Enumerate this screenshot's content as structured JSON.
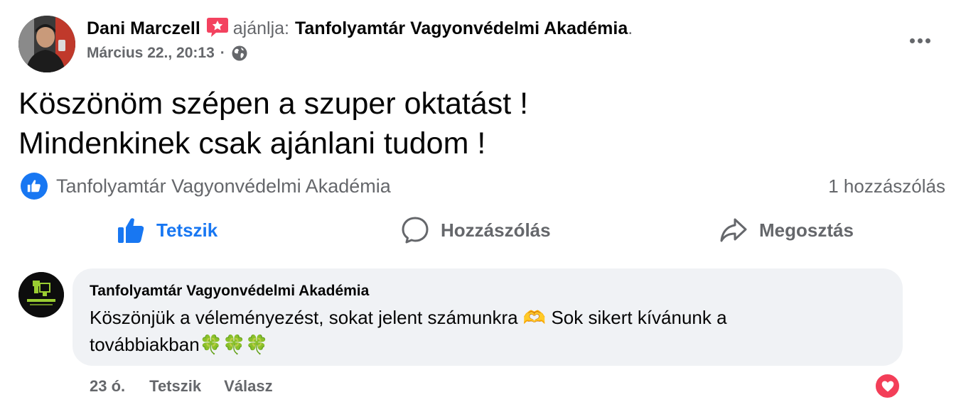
{
  "post": {
    "author": "Dani Marczell",
    "recommend_verb": "ajánlja:",
    "page_name": "Tanfolyamtár Vagyonvédelmi Akadémia",
    "period": ".",
    "timestamp": "Március 22., 20:13",
    "separator": "·",
    "audience_icon": "globe-icon",
    "recommend_icon": "recommend-star-icon",
    "more_icon": "more-options-icon",
    "text_lines": [
      "Köszönöm szépen a szuper oktatást !",
      "Mindenkinek csak ajánlani tudom !"
    ]
  },
  "reactions": {
    "icon": "like-icon",
    "reactors": "Tanfolyamtár Vagyonvédelmi Akadémia",
    "comment_count": "1 hozzászólás"
  },
  "actions": {
    "like": "Tetszik",
    "comment": "Hozzászólás",
    "share": "Megosztás"
  },
  "comment": {
    "author": "Tanfolyamtár Vagyonvédelmi Akadémia",
    "text_lines": [
      "Köszönjük a véleményezést, sokat jelent számunkra 🫶 Sok sikert kívánunk a",
      "továbbiakban🍀🍀🍀"
    ],
    "time": "23 ó.",
    "like": "Tetszik",
    "reply": "Válasz",
    "reaction_icon": "heart-icon"
  },
  "colors": {
    "accent": "#1877f2",
    "secondary_text": "#65676b",
    "bubble": "#f0f2f5",
    "heart": "#f33e58",
    "recommend": "#f3425f"
  }
}
